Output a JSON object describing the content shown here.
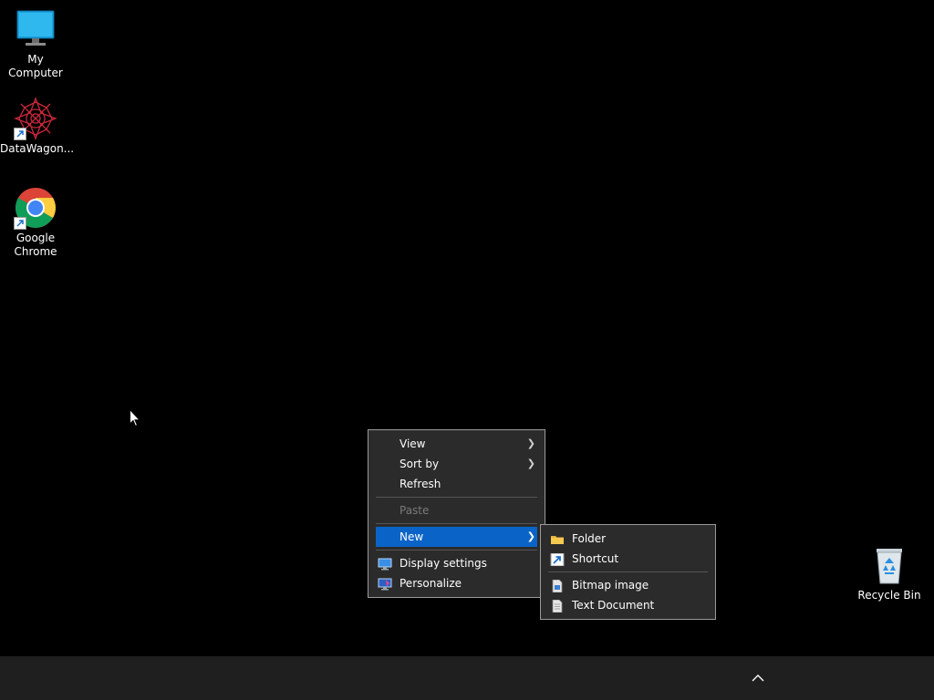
{
  "desktop": {
    "icons": [
      {
        "label": "My Computer",
        "icon": "monitor-icon"
      },
      {
        "label": "DataWagon...",
        "icon": "datawagon-icon"
      },
      {
        "label": "Google Chrome",
        "icon": "chrome-icon"
      },
      {
        "label": "Recycle Bin",
        "icon": "recycle-bin-icon"
      }
    ]
  },
  "context_menu": {
    "items": [
      {
        "label": "View",
        "has_submenu": true
      },
      {
        "label": "Sort by",
        "has_submenu": true
      },
      {
        "label": "Refresh"
      },
      {
        "label": "Paste",
        "disabled": true
      },
      {
        "label": "New",
        "has_submenu": true,
        "highlighted": true
      },
      {
        "label": "Display settings",
        "icon": "display-settings-icon"
      },
      {
        "label": "Personalize",
        "icon": "personalize-icon"
      }
    ],
    "highlight_color": "#0a64c8"
  },
  "new_submenu": {
    "items": [
      {
        "label": "Folder",
        "icon": "folder-icon"
      },
      {
        "label": "Shortcut",
        "icon": "shortcut-icon"
      },
      {
        "label": "Bitmap image",
        "icon": "bitmap-icon"
      },
      {
        "label": "Text Document",
        "icon": "text-document-icon"
      }
    ]
  },
  "taskbar": {
    "tray_icon": "chevron-up-icon"
  }
}
